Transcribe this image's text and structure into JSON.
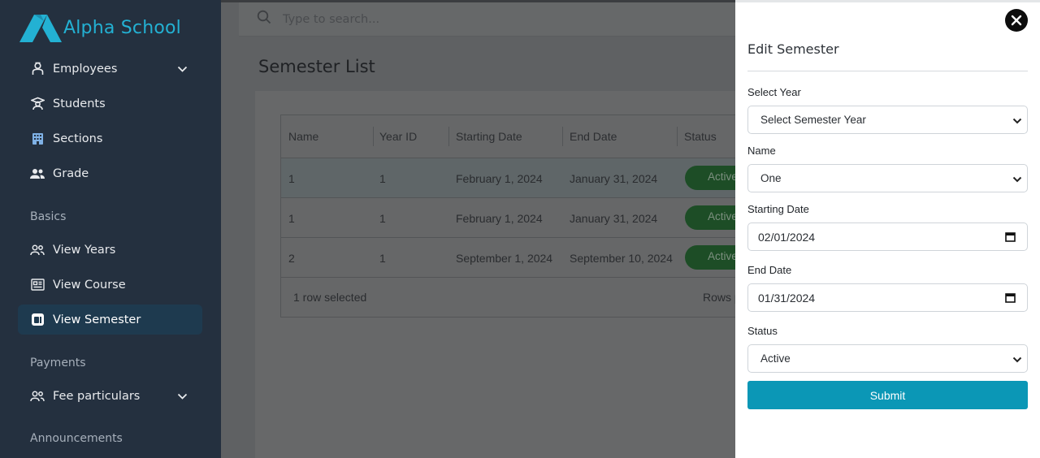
{
  "app": {
    "name": "Alpha School",
    "brand_color": "#23b1d3"
  },
  "sidebar": {
    "items": [
      {
        "label": "Employees",
        "icon": "employee-icon",
        "has_chevron": true
      },
      {
        "label": "Students",
        "icon": "student-icon"
      },
      {
        "label": "Sections",
        "icon": "building-icon"
      },
      {
        "label": "Grade",
        "icon": "users-icon"
      }
    ],
    "sections": [
      {
        "label": "Basics",
        "items": [
          {
            "label": "View Years",
            "icon": "users-icon"
          },
          {
            "label": "View Course",
            "icon": "course-icon"
          },
          {
            "label": "View Semester",
            "icon": "semester-icon",
            "active": true
          }
        ]
      },
      {
        "label": "Payments",
        "items": [
          {
            "label": "Fee particulars",
            "icon": "users-icon",
            "has_chevron": true
          }
        ]
      },
      {
        "label": "Announcements",
        "items": []
      }
    ]
  },
  "search": {
    "placeholder": "Type to search..."
  },
  "page": {
    "title": "Semester List"
  },
  "table": {
    "columns": [
      "Name",
      "Year ID",
      "Starting Date",
      "End Date",
      "Status"
    ],
    "rows": [
      {
        "name": "1",
        "year_id": "1",
        "start": "February 1, 2024",
        "end": "January 31, 2024",
        "status": "Active",
        "selected": true
      },
      {
        "name": "1",
        "year_id": "1",
        "start": "February 1, 2024",
        "end": "January 31, 2024",
        "status": "Active"
      },
      {
        "name": "2",
        "year_id": "1",
        "start": "September 1, 2024",
        "end": "September 10, 2024",
        "status": "Active"
      }
    ],
    "footer": {
      "selection": "1 row selected",
      "rows_per_page": "Rows p"
    }
  },
  "drawer": {
    "title": "Edit Semester",
    "fields": {
      "year": {
        "label": "Select Year",
        "value": "Select Semester Year"
      },
      "name": {
        "label": "Name",
        "value": "One"
      },
      "start": {
        "label": "Starting Date",
        "value": "02/01/2024"
      },
      "end": {
        "label": "End Date",
        "value": "01/31/2024"
      },
      "status": {
        "label": "Status",
        "value": "Active"
      }
    },
    "submit_label": "Submit",
    "submit_color": "#0b97b6"
  }
}
